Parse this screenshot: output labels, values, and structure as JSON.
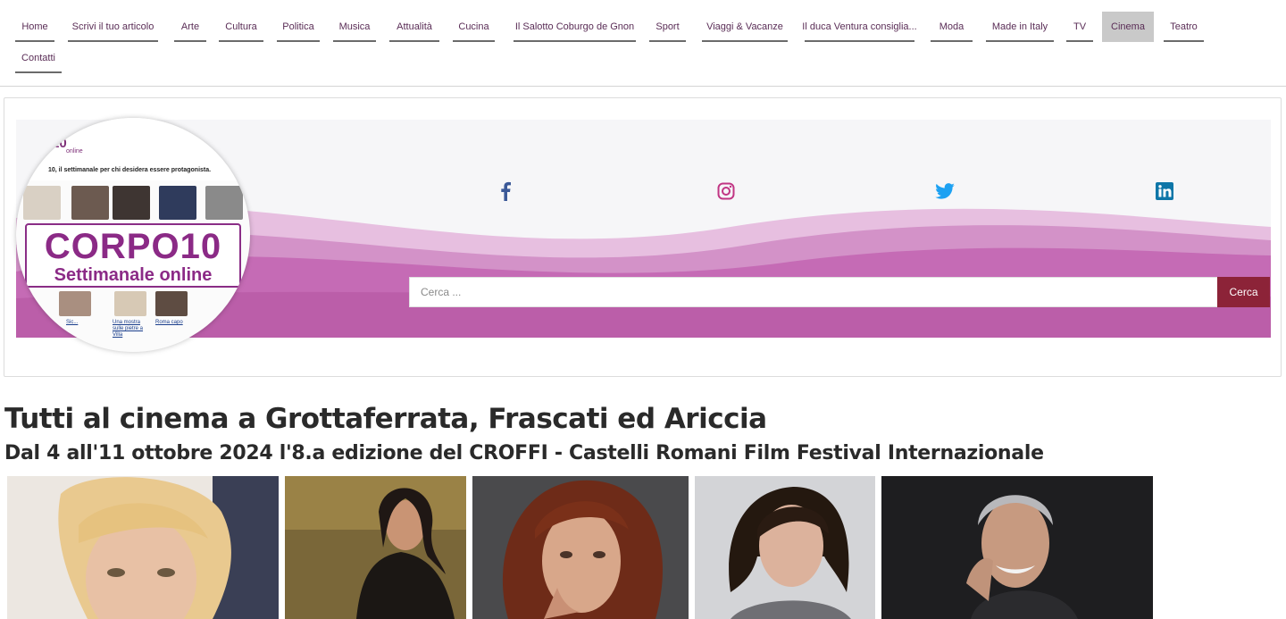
{
  "nav": {
    "items": [
      {
        "label": "Home",
        "active": false
      },
      {
        "label": "Scrivi il tuo articolo",
        "active": false
      },
      {
        "label": "Arte",
        "active": false
      },
      {
        "label": "Cultura",
        "active": false
      },
      {
        "label": "Politica",
        "active": false
      },
      {
        "label": "Musica",
        "active": false
      },
      {
        "label": "Attualità",
        "active": false
      },
      {
        "label": "Cucina",
        "active": false
      },
      {
        "label": "Il Salotto Coburgo de Gnon",
        "active": false
      },
      {
        "label": "Sport",
        "active": false
      },
      {
        "label": "Viaggi & Vacanze",
        "active": false
      },
      {
        "label": "Il duca Ventura consiglia...",
        "active": false
      },
      {
        "label": "Moda",
        "active": false
      },
      {
        "label": "Made in Italy",
        "active": false
      },
      {
        "label": "TV",
        "active": false
      },
      {
        "label": "Cinema",
        "active": true
      },
      {
        "label": "Teatro",
        "active": false
      },
      {
        "label": "Contatti",
        "active": false
      }
    ]
  },
  "header": {
    "logo_title": "CORPO10",
    "logo_subtitle": "Settimanale online",
    "mini_logo": "10",
    "mini_logo_sub": "online",
    "mini_tagline": "10, il settimanale per chi desidera essere protagonista.",
    "mini_links": [
      "Sic...",
      "Una mostra sulle pietre a Villa",
      "Roma capo"
    ],
    "social": [
      {
        "icon": "facebook-icon",
        "color": "#3b5998"
      },
      {
        "icon": "instagram-icon",
        "color": "#c13584"
      },
      {
        "icon": "twitter-icon",
        "color": "#1da1f2"
      },
      {
        "icon": "linkedin-icon",
        "color": "#0e76a8"
      }
    ],
    "search": {
      "placeholder": "Cerca ...",
      "button": "Cerca"
    },
    "colors": {
      "accent": "#8b2a86",
      "wave": "#c76bb4",
      "button": "#8c2338"
    }
  },
  "article": {
    "title": "Tutti al cinema a Grottaferrata, Frascati ed Ariccia",
    "subtitle": "Dal 4 all'11 ottobre 2024 l'8.a edizione del CROFFI - Castelli Romani Film Festival Internazionale"
  }
}
